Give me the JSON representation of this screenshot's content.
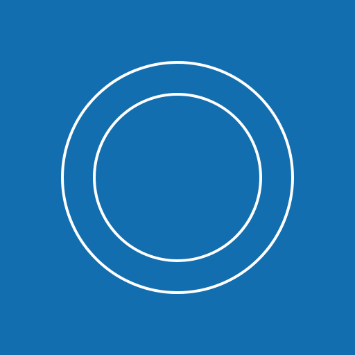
{
  "icon": {
    "name": "concentric-rings-icon",
    "background_color": "#136EAF",
    "stroke_color": "#FFFFFF"
  }
}
